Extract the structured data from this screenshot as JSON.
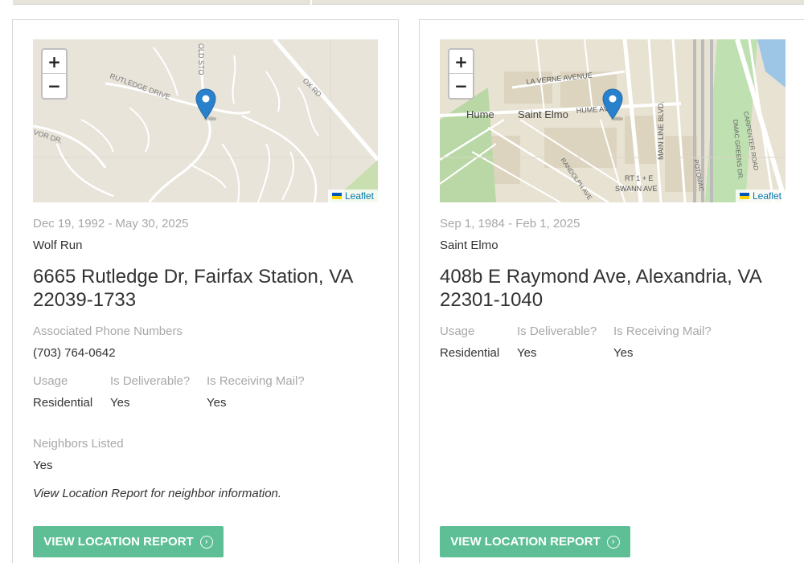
{
  "map_common": {
    "zoom_in": "+",
    "zoom_out": "−",
    "attribution": "Leaflet"
  },
  "cards": [
    {
      "dates": "Dec 19, 1992 - May 30, 2025",
      "neighborhood": "Wolf Run",
      "address_line1": "6665 Rutledge Dr, Fairfax Station, VA",
      "address_line2": "22039-1733",
      "phones_label": "Associated Phone Numbers",
      "phone": "(703) 764-0642",
      "usage_label": "Usage",
      "usage": "Residential",
      "deliverable_label": "Is Deliverable?",
      "deliverable": "Yes",
      "mail_label": "Is Receiving Mail?",
      "mail": "Yes",
      "neighbors_label": "Neighbors Listed",
      "neighbors": "Yes",
      "neighbor_note": "View Location Report for neighbor information.",
      "button": "VIEW LOCATION REPORT",
      "map_labels": {
        "rutledge": "RUTLEDGE DRIVE",
        "old": "OLD STO",
        "ox": "OX RD",
        "vor": "VOR DR."
      }
    },
    {
      "dates": "Sep 1, 1984 - Feb 1, 2025",
      "neighborhood": "Saint Elmo",
      "address_line1": "408b E Raymond Ave, Alexandria, VA",
      "address_line2": "22301-1040",
      "usage_label": "Usage",
      "usage": "Residential",
      "deliverable_label": "Is Deliverable?",
      "deliverable": "Yes",
      "mail_label": "Is Receiving Mail?",
      "mail": "Yes",
      "button": "VIEW LOCATION REPORT",
      "map_labels": {
        "laverne": "LA VERNE AVENUE",
        "hume": "Hume",
        "saintelmo": "Saint Elmo",
        "humeave": "HUME AVE",
        "mainline": "MAIN LINE BLVD.",
        "rt1": "RT 1 + E",
        "swann": "SWANN AVE",
        "randolph": "RANDOLPH AVE",
        "potomac": "POTOMAC",
        "carpenter": "CARPENTER ROAD",
        "dmac": "DMAC GREENS DR."
      }
    }
  ]
}
